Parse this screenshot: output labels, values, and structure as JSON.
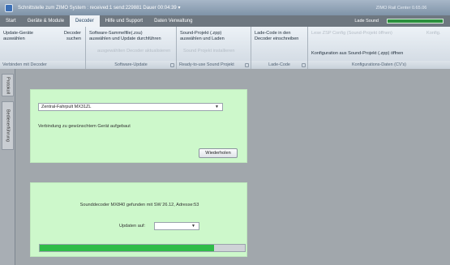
{
  "window": {
    "title": "Schnittstelle zum ZIMO System : received:1 send:229881 Dauer 00:04:39",
    "app_name": "ZIMO Rail Center 0.65.06",
    "title_dropdown_icon": "chevron-down-icon"
  },
  "menu": {
    "items": [
      "Start",
      "Geräte & Module",
      "Decoder",
      "Hilfe und Support",
      "Daten Verwaltung"
    ],
    "active": "Decoder",
    "lade_sound_label": "Lade Sound",
    "lade_sound_progress": 1.0
  },
  "ribbon": {
    "groups": [
      {
        "label": "Verbinden mit Decoder",
        "buttons": [
          {
            "line1": "Update-Geräte",
            "line2": "auswählen",
            "enabled": true
          },
          {
            "line1": "Decoder",
            "line2": "suchen",
            "enabled": true
          }
        ]
      },
      {
        "label": "Software-Update",
        "buttons": [
          {
            "line1": "Software-Sammelfile(.zsu)",
            "line2": "auswählen und Update durchführen",
            "enabled": true
          },
          {
            "line1": "",
            "line2": "ausgewählten Decoder aktualisieren",
            "enabled": false
          }
        ]
      },
      {
        "label": "Ready-to-use Sound Projekt",
        "buttons": [
          {
            "line1": "Sound-Projekt (.zpp)",
            "line2": "auswählen und Laden",
            "enabled": true
          },
          {
            "line1": "",
            "line2": "Sound Projekt installieren",
            "enabled": false
          }
        ]
      },
      {
        "label": "Lade-Code",
        "buttons": [
          {
            "line1": "Lade-Code in den",
            "line2": "Decoder einschreiben",
            "enabled": true
          }
        ]
      },
      {
        "label": "Konfigurations-Daten (CV's)",
        "buttons": [
          {
            "line1": "Lese ZSP Config (Sound-Projekt öffnen)",
            "line2": "",
            "enabled": false
          },
          {
            "line1": "Konfiguration aus Sound-Projekt (.zpp) öffnen",
            "line2": "",
            "enabled": true
          },
          {
            "line1": "Konfig.",
            "line2": "",
            "enabled": false
          }
        ]
      }
    ]
  },
  "left_tabs": [
    "Protokoll",
    "Bedienerführung"
  ],
  "panel1": {
    "device_select": "Zentral-Fahrpult MX31ZL",
    "status_text": "Verbindung zu gewünschtem Gerät aufgebaut",
    "retry_button": "Wiederholen"
  },
  "panel2": {
    "decoder_text": "Sounddecoder MX840 gefunden mit SW 26.12, Adresse:53",
    "update_label": "Updaten auf:",
    "update_select": "",
    "progress": 0.85
  },
  "colors": {
    "panel_bg": "#cdf8cb",
    "progress_fill": "#2fbc48",
    "active_menu": "#eef2f6"
  }
}
